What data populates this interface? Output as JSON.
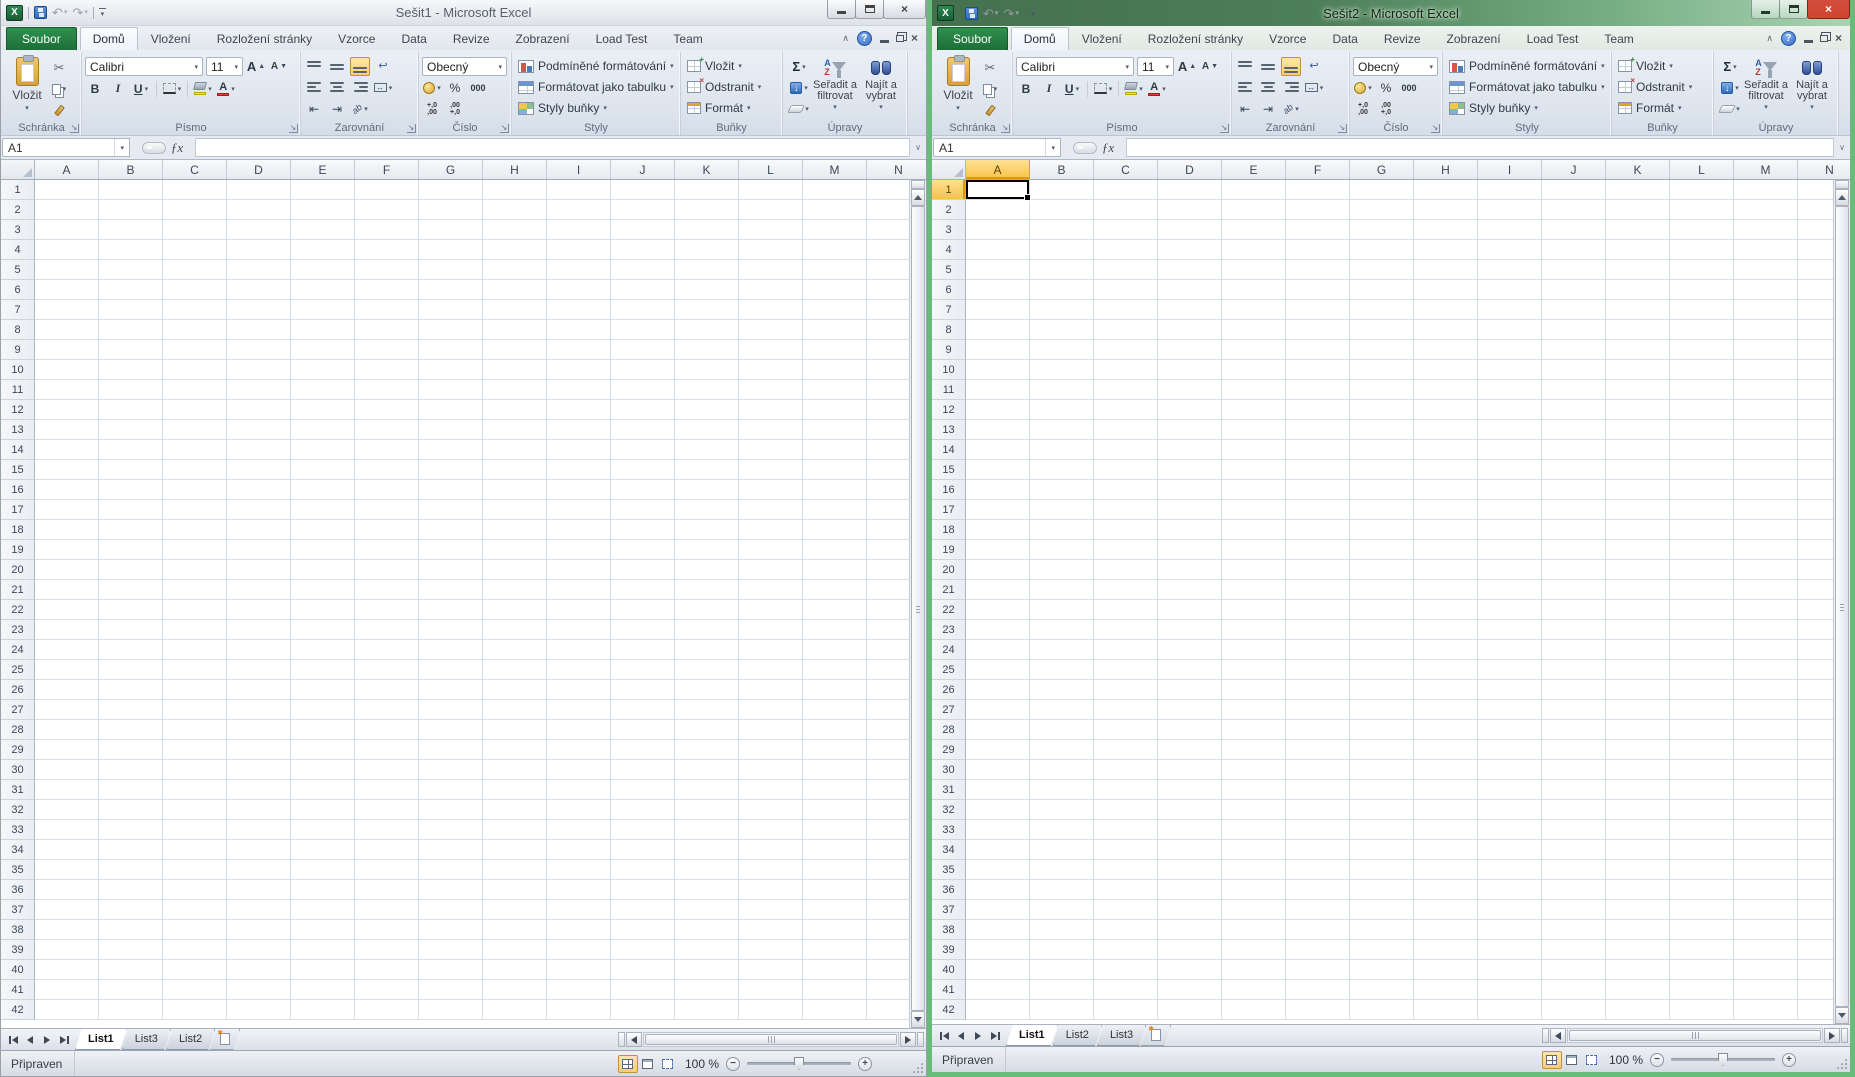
{
  "colors": {
    "active_frame": "#68bb78",
    "file_tab_green": "#1d6e36",
    "selection_header": "#f9c24a",
    "close_red": "#cf4433",
    "help_blue": "#3b6fc4"
  },
  "windows": [
    {
      "title": "Sešit1 - Microsoft Excel",
      "active": false,
      "name_box": "A1",
      "formula_value": "",
      "sheets": [
        "List1",
        "List3",
        "List2"
      ],
      "active_sheet": "List1",
      "has_selection": false,
      "status": "Připraven",
      "zoom": "100 %"
    },
    {
      "title": "Sešit2 - Microsoft Excel",
      "active": true,
      "name_box": "A1",
      "formula_value": "",
      "sheets": [
        "List1",
        "List2",
        "List3"
      ],
      "active_sheet": "List1",
      "has_selection": true,
      "selection": {
        "col": "A",
        "row": 1
      },
      "status": "Připraven",
      "zoom": "100 %"
    }
  ],
  "ribbon": {
    "file_tab": "Soubor",
    "tabs": [
      "Domů",
      "Vložení",
      "Rozložení stránky",
      "Vzorce",
      "Data",
      "Revize",
      "Zobrazení",
      "Load Test",
      "Team"
    ],
    "active_tab": "Domů",
    "groups": {
      "clipboard": {
        "label": "Schránka",
        "paste": "Vložit"
      },
      "font": {
        "label": "Písmo",
        "font_name": "Calibri",
        "font_size": "11",
        "bold": "B",
        "italic": "I",
        "underline": "U",
        "grow": "A",
        "shrink": "A",
        "color_letter": "A"
      },
      "alignment": {
        "label": "Zarovnání"
      },
      "number": {
        "label": "Číslo",
        "format": "Obecný",
        "percent": "%",
        "thousands": "000",
        "inc_top": "+,0",
        "inc_bottom": ",00",
        "dec_top": ",00",
        "dec_bottom": "+,0"
      },
      "styles": {
        "label": "Styly",
        "items": [
          "Podmíněné formátování",
          "Formátovat jako tabulku",
          "Styly buňky"
        ]
      },
      "cells": {
        "label": "Buňky",
        "items": [
          "Vložit",
          "Odstranit",
          "Formát"
        ]
      },
      "editing": {
        "label": "Úpravy",
        "sum": "Σ",
        "sort": "Seřadit a filtrovat",
        "find": "Najít a vybrat"
      }
    }
  },
  "formula": {
    "fx": "ƒx"
  },
  "grid": {
    "columns": [
      "A",
      "B",
      "C",
      "D",
      "E",
      "F",
      "G",
      "H",
      "I",
      "J",
      "K",
      "L",
      "M",
      "N"
    ],
    "rows": [
      1,
      2,
      3,
      4,
      5,
      6,
      7,
      8,
      9,
      10,
      11,
      12,
      13,
      14,
      15,
      16,
      17,
      18,
      19,
      20,
      21,
      22,
      23,
      24,
      25,
      26,
      27,
      28,
      29,
      30,
      31,
      32,
      33,
      34,
      35,
      36,
      37,
      38,
      39,
      40,
      41,
      42
    ]
  }
}
